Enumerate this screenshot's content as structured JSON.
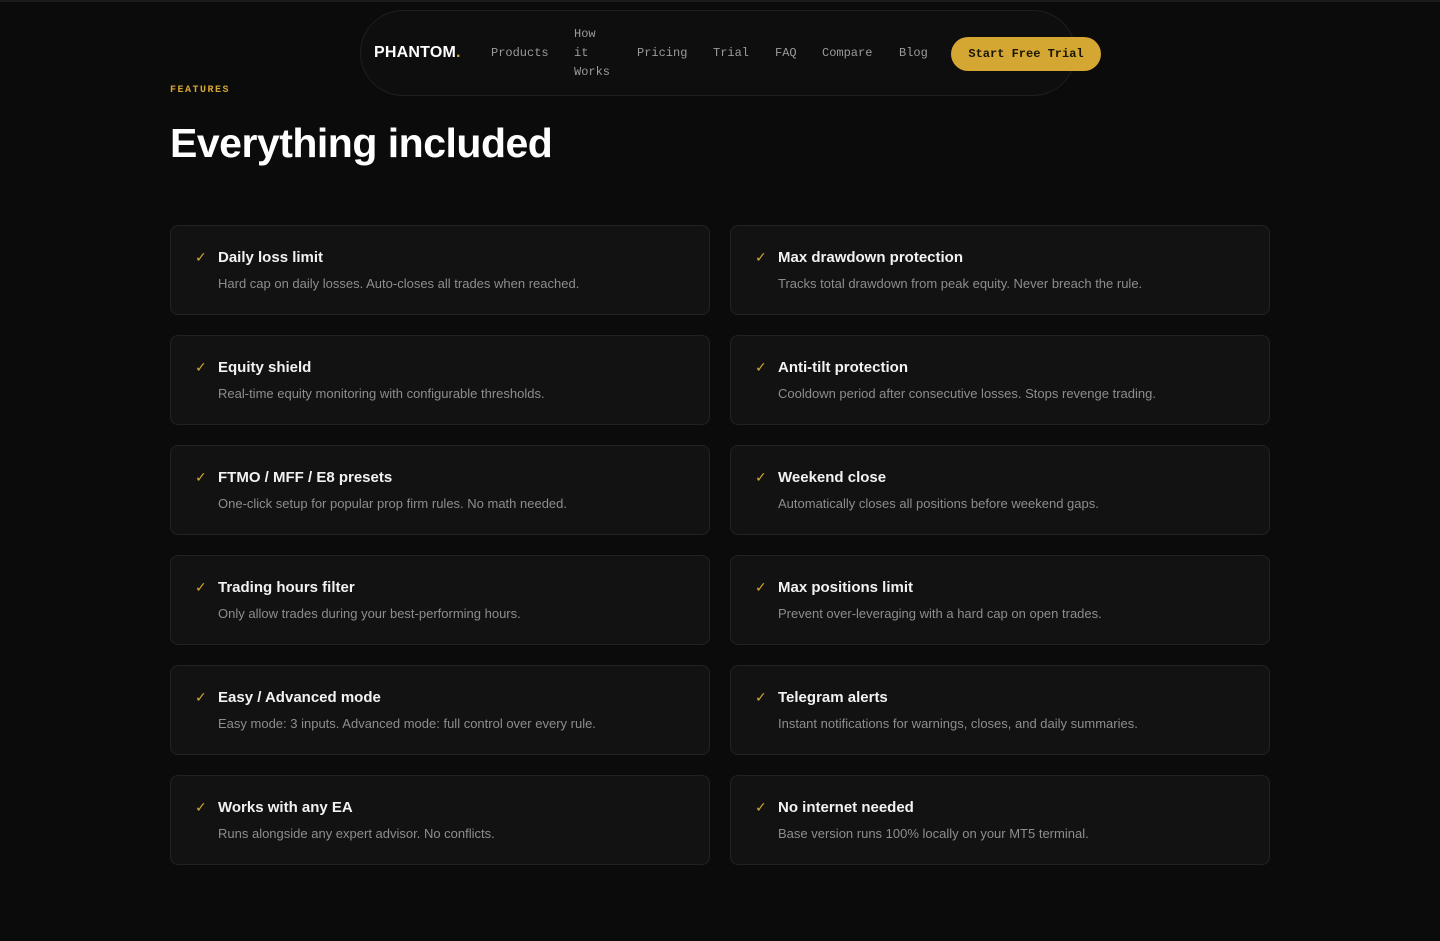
{
  "nav": {
    "logo_text": "PHANTOM",
    "logo_dot": ".",
    "links": [
      {
        "label": "Products"
      },
      {
        "label": "How it Works"
      },
      {
        "label": "Pricing"
      },
      {
        "label": "Trial"
      },
      {
        "label": "FAQ"
      },
      {
        "label": "Compare"
      },
      {
        "label": "Blog"
      }
    ],
    "cta_label": "Start Free Trial"
  },
  "features": {
    "eyebrow": "FEATURES",
    "title": "Everything included",
    "items": [
      {
        "icon": "check-icon",
        "title": "Daily loss limit",
        "desc": "Hard cap on daily losses. Auto-closes all trades when reached."
      },
      {
        "icon": "check-icon",
        "title": "Max drawdown protection",
        "desc": "Tracks total drawdown from peak equity. Never breach the rule."
      },
      {
        "icon": "check-icon",
        "title": "Equity shield",
        "desc": "Real-time equity monitoring with configurable thresholds."
      },
      {
        "icon": "check-icon",
        "title": "Anti-tilt protection",
        "desc": "Cooldown period after consecutive losses. Stops revenge trading."
      },
      {
        "icon": "check-icon",
        "title": "FTMO / MFF / E8 presets",
        "desc": "One-click setup for popular prop firm rules. No math needed."
      },
      {
        "icon": "check-icon",
        "title": "Weekend close",
        "desc": "Automatically closes all positions before weekend gaps."
      },
      {
        "icon": "check-icon",
        "title": "Trading hours filter",
        "desc": "Only allow trades during your best-performing hours."
      },
      {
        "icon": "check-icon",
        "title": "Max positions limit",
        "desc": "Prevent over-leveraging with a hard cap on open trades."
      },
      {
        "icon": "check-icon",
        "title": "Easy / Advanced mode",
        "desc": "Easy mode: 3 inputs. Advanced mode: full control over every rule."
      },
      {
        "icon": "check-icon",
        "title": "Telegram alerts",
        "desc": "Instant notifications for warnings, closes, and daily summaries."
      },
      {
        "icon": "check-icon",
        "title": "Works with any EA",
        "desc": "Runs alongside any expert advisor. No conflicts."
      },
      {
        "icon": "check-icon",
        "title": "No internet needed",
        "desc": "Base version runs 100% locally on your MT5 terminal."
      }
    ]
  },
  "colors": {
    "accent": "#d4a632",
    "background": "#0b0b0b",
    "card": "#121212"
  }
}
